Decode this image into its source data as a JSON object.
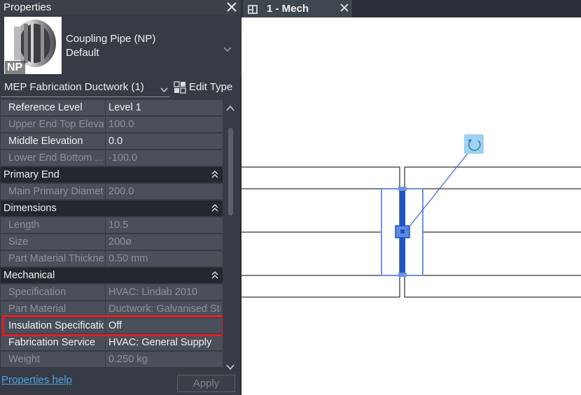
{
  "properties_panel": {
    "title": "Properties",
    "type_selector": {
      "family": "Coupling Pipe (NP)",
      "type": "Default",
      "thumbnail_badge": "NP"
    },
    "filter": {
      "selected": "MEP Fabrication Ductwork (1)",
      "edit_type_label": "Edit Type"
    },
    "rows": [
      {
        "kind": "prop",
        "key": "Reference Level",
        "value": "Level 1",
        "readonly": false
      },
      {
        "kind": "prop",
        "key": "Upper End Top Elevation",
        "value": "100.0",
        "readonly": true
      },
      {
        "kind": "prop",
        "key": "Middle Elevation",
        "value": "0.0",
        "readonly": false
      },
      {
        "kind": "prop",
        "key": "Lower End Bottom ...",
        "value": "-100.0",
        "readonly": true
      },
      {
        "kind": "group",
        "label": "Primary End"
      },
      {
        "kind": "prop",
        "key": "Main Primary Diameter",
        "value": "200.0",
        "readonly": true
      },
      {
        "kind": "group",
        "label": "Dimensions"
      },
      {
        "kind": "prop",
        "key": "Length",
        "value": "10.5",
        "readonly": true
      },
      {
        "kind": "prop",
        "key": "Size",
        "value": "200ø",
        "readonly": true
      },
      {
        "kind": "prop",
        "key": "Part Material Thickness",
        "value": "0.50 mm",
        "readonly": true
      },
      {
        "kind": "group",
        "label": "Mechanical"
      },
      {
        "kind": "prop",
        "key": "Specification",
        "value": "HVAC: Lindab 2010",
        "readonly": true
      },
      {
        "kind": "prop",
        "key": "Part Material",
        "value": "Ductwork: Galvanised Steel",
        "readonly": true
      },
      {
        "kind": "prop",
        "key": "Insulation Specification",
        "value": "Off",
        "readonly": false
      },
      {
        "kind": "prop",
        "key": "Fabrication Service",
        "value": "HVAC: General Supply",
        "readonly": false
      },
      {
        "kind": "prop",
        "key": "Weight",
        "value": "0.250 kg",
        "readonly": true
      }
    ],
    "help_link": "Properties help",
    "apply_label": "Apply"
  },
  "view": {
    "tab_label": "1 - Mech"
  },
  "colors": {
    "panel_bg": "#363b45",
    "row_bg": "#4a4f5a",
    "group_bg": "#23272e",
    "highlight": "#e0202a",
    "link": "#4ea3e6",
    "selection_blue": "#1c55c4"
  }
}
